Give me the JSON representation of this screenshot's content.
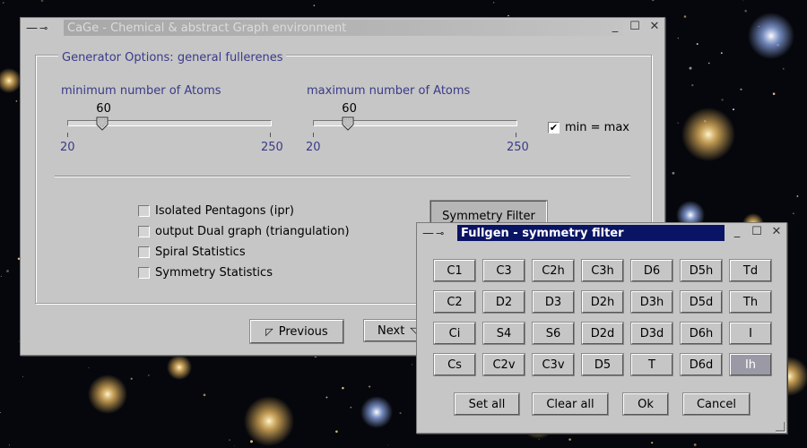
{
  "main_window": {
    "title": "CaGe - Chemical & abstract Graph environment",
    "titlebar_icons": [
      "minus-icon",
      "pin-icon"
    ],
    "controls": [
      "minimize-icon",
      "maximize-icon",
      "close-icon"
    ],
    "group_title": "Generator Options:  general fullerenes",
    "min_slider": {
      "label": "minimum number of Atoms",
      "value": "60",
      "value_num": 60,
      "min": "20",
      "max": "250",
      "min_num": 20,
      "max_num": 250
    },
    "max_slider": {
      "label": "maximum number of Atoms",
      "value": "60",
      "value_num": 60,
      "min": "20",
      "max": "250",
      "min_num": 20,
      "max_num": 250
    },
    "min_eq_max": {
      "label": "min = max",
      "checked": true,
      "check_glyph": "✔"
    },
    "options": [
      {
        "label": "Isolated Pentagons (ipr)",
        "checked": false
      },
      {
        "label": "output Dual graph (triangulation)",
        "checked": false
      },
      {
        "label": "Spiral Statistics",
        "checked": false
      },
      {
        "label": "Symmetry Statistics",
        "checked": false
      }
    ],
    "symmetry_filter_button": "Symmetry Filter",
    "previous_button": "Previous",
    "next_button": "Next"
  },
  "dialog": {
    "title": "Fullgen - symmetry filter",
    "symmetries": [
      [
        "C1",
        "C3",
        "C2h",
        "C3h",
        "D6",
        "D5h",
        "Td"
      ],
      [
        "C2",
        "D2",
        "D3",
        "D2h",
        "D3h",
        "D5d",
        "Th"
      ],
      [
        "Ci",
        "S4",
        "S6",
        "D2d",
        "D3d",
        "D6h",
        "I"
      ],
      [
        "Cs",
        "C2v",
        "C3v",
        "D5",
        "T",
        "D6d",
        "Ih"
      ]
    ],
    "selected": [
      "Ih"
    ],
    "set_all": "Set all",
    "clear_all": "Clear all",
    "ok": "Ok",
    "cancel": "Cancel"
  },
  "colors": {
    "window_bg": "#c6c6c6",
    "accent_text": "#3a3a8a",
    "active_title": "#0a1464"
  }
}
